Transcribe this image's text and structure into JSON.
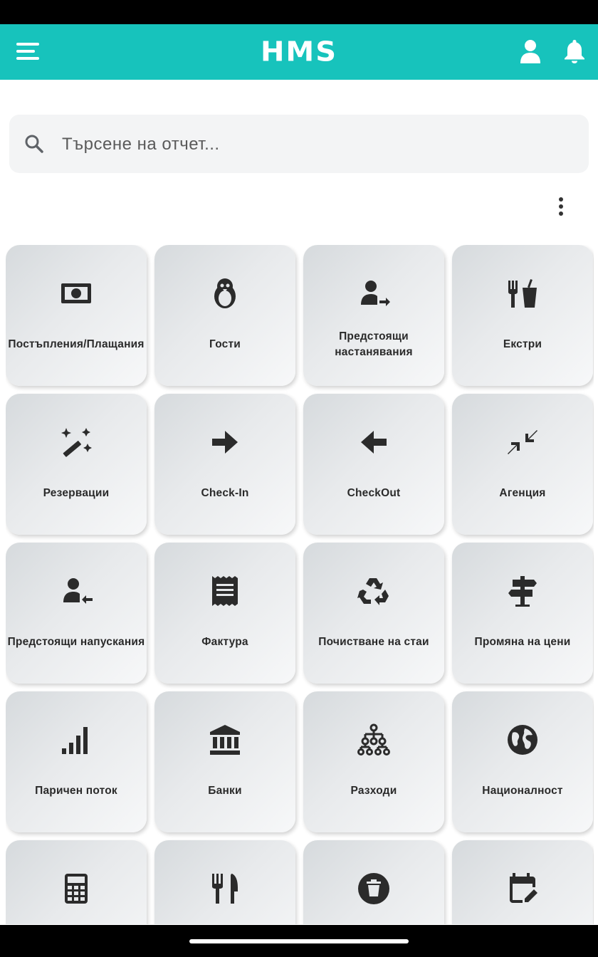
{
  "app_bar": {
    "title": "HMS",
    "color": "#17c3bc",
    "left_icon": "menu-icon",
    "right_icons": [
      "user-icon",
      "bell-icon"
    ]
  },
  "search": {
    "placeholder": "Търсене на отчет...",
    "value": "",
    "icon": "search-icon"
  },
  "more_menu_icon": "more-vertical-icon",
  "tiles": [
    {
      "label": "Постъпления/Плащания",
      "icon": "money-icon"
    },
    {
      "label": "Гости",
      "icon": "penguin-icon"
    },
    {
      "label": "Предстоящи настанявания",
      "icon": "person-arrival-icon"
    },
    {
      "label": "Екстри",
      "icon": "utensils-drink-icon"
    },
    {
      "label": "Резервации",
      "icon": "magic-wand-icon"
    },
    {
      "label": "Check-In",
      "icon": "arrow-right-icon"
    },
    {
      "label": "CheckOut",
      "icon": "arrow-left-icon"
    },
    {
      "label": "Агенция",
      "icon": "compress-arrows-icon"
    },
    {
      "label": "Предстоящи напускания",
      "icon": "person-departure-icon"
    },
    {
      "label": "Фактура",
      "icon": "receipt-icon"
    },
    {
      "label": "Почистване на стаи",
      "icon": "recycle-icon"
    },
    {
      "label": "Промяна на цени",
      "icon": "signpost-icon"
    },
    {
      "label": "Паричен поток",
      "icon": "signal-bars-icon"
    },
    {
      "label": "Банки",
      "icon": "bank-icon"
    },
    {
      "label": "Разходи",
      "icon": "sitemap-icon"
    },
    {
      "label": "Националност",
      "icon": "globe-icon"
    },
    {
      "label": "",
      "icon": "calculator-icon"
    },
    {
      "label": "",
      "icon": "utensils-icon"
    },
    {
      "label": "",
      "icon": "trash-icon"
    },
    {
      "label": "",
      "icon": "calendar-edit-icon"
    }
  ]
}
